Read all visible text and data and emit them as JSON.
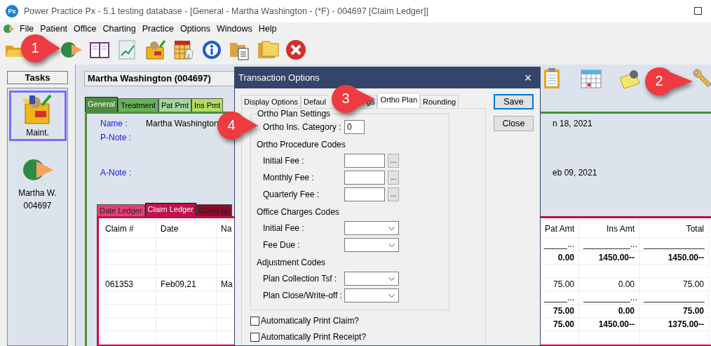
{
  "window": {
    "logo": "Px",
    "title": "Power Practice Px - 5.1 testing database - [General - Martha Washington - (*F) - 004697 [Claim Ledger]]"
  },
  "menu": [
    "File",
    "Patient",
    "Office",
    "Charting",
    "Practice",
    "Options",
    "Windows",
    "Help"
  ],
  "tasks": {
    "title": "Tasks",
    "items": [
      {
        "kind": "maintenance",
        "label": "Maint.",
        "selected": true
      },
      {
        "kind": "patient",
        "label": "Martha W.",
        "sublabel": "004697",
        "selected": false
      }
    ]
  },
  "patient": {
    "header": "Martha Washington (004697)"
  },
  "patient_tabs": [
    {
      "label": "General",
      "selected": true,
      "color": "#4a8c3c"
    },
    {
      "label": "Treatment",
      "selected": false,
      "color": "#66b457"
    },
    {
      "label": "Pat Pmt",
      "selected": false,
      "color": "#a3d89a"
    },
    {
      "label": "Ins Pmt",
      "selected": false,
      "color": "#b5dc5e"
    }
  ],
  "fields": [
    {
      "label": "Name :",
      "value": "Martha Washington",
      "date": "n 18, 2021"
    },
    {
      "label": "P-Note :"
    },
    {
      "label": "A-Note :",
      "date": "eb 09, 2021"
    }
  ],
  "ledger_tabs": [
    {
      "label": "Date Ledger",
      "selected": false,
      "color": "#e23e78"
    },
    {
      "label": "Claim Ledger",
      "selected": true,
      "color": "#c0104e"
    },
    {
      "label": "Claim by",
      "selected": false,
      "color": "#8c0c2a"
    }
  ],
  "ledger": {
    "columns": [
      "Claim #",
      "Date",
      "Na",
      "Pat Amt",
      "Ins Amt",
      "Total"
    ],
    "rows": [
      {
        "bold": false,
        "cells": [
          "",
          "",
          "",
          "_____...",
          "__________...",
          "_____________"
        ]
      },
      {
        "bold": true,
        "cells": [
          "",
          "",
          "",
          "0.00",
          "1450.00--",
          "1450.00--"
        ]
      },
      {
        "cells": [
          "",
          "",
          "",
          "",
          "",
          ""
        ]
      },
      {
        "bold": false,
        "cells": [
          "061353",
          "Feb09,21",
          "Ma",
          "75.00",
          "0.00",
          "75.00"
        ]
      },
      {
        "bold": false,
        "cells": [
          "",
          "",
          "",
          "_____...",
          "__________...",
          "_____________"
        ]
      },
      {
        "bold": true,
        "cells": [
          "",
          "",
          "",
          "75.00",
          "0.00",
          "75.00"
        ]
      },
      {
        "bold": true,
        "cells": [
          "",
          "",
          "",
          "75.00",
          "1450.00--",
          "1375.00--"
        ]
      },
      {
        "cells": [
          "",
          "",
          "",
          "",
          "",
          ""
        ]
      }
    ]
  },
  "dialog": {
    "title": "Transaction Options",
    "close": "×",
    "tabs": [
      {
        "label": "Display Options",
        "selected": false
      },
      {
        "label": "Defaul",
        "selected": false
      },
      {
        "label": "gs",
        "selected": false
      },
      {
        "label": "Ortho Plan",
        "selected": true
      },
      {
        "label": "Rounding",
        "selected": false
      }
    ],
    "group_title": "Ortho Plan Settings",
    "rows": [
      {
        "kind": "text",
        "label": "Ortho Ins. Category :",
        "value": "0"
      },
      {
        "kind": "heading",
        "label": "Ortho Procedure Codes"
      },
      {
        "kind": "lookup",
        "label": "Initial Fee :",
        "button": "..."
      },
      {
        "kind": "lookup",
        "label": "Monthly Fee :",
        "button": "..."
      },
      {
        "kind": "lookup",
        "label": "Quarterly Fee :",
        "button": "..."
      },
      {
        "kind": "heading",
        "label": "Office Charges Codes"
      },
      {
        "kind": "select",
        "label": "Initial Fee :"
      },
      {
        "kind": "select",
        "label": "Fee Due :"
      },
      {
        "kind": "heading",
        "label": "Adjustment Codes"
      },
      {
        "kind": "select",
        "label": "Plan Collection Tsf :"
      },
      {
        "kind": "select",
        "label": "Plan Close/Write-off :"
      }
    ],
    "checkboxes": [
      {
        "label": "Automatically Print Claim?",
        "checked": false
      },
      {
        "label": "Automatically Print Receipt?",
        "checked": false
      }
    ],
    "buttons": [
      {
        "label": "Save",
        "default": true
      },
      {
        "label": "Close",
        "default": false
      }
    ]
  },
  "callouts": [
    "1",
    "2",
    "3",
    "4"
  ]
}
